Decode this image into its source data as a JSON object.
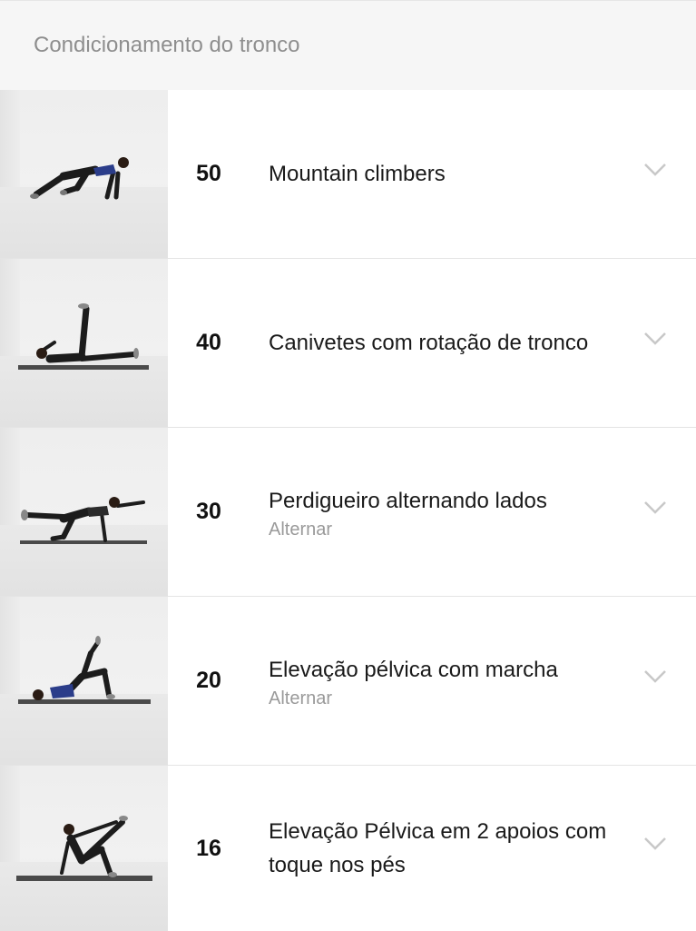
{
  "header": {
    "title": "Condicionamento do tronco"
  },
  "exercises": [
    {
      "reps": "50",
      "name": "Mountain climbers",
      "sub": ""
    },
    {
      "reps": "40",
      "name": "Canivetes com rotação de tronco",
      "sub": ""
    },
    {
      "reps": "30",
      "name": "Perdigueiro alternando lados",
      "sub": "Alternar"
    },
    {
      "reps": "20",
      "name": "Elevação pélvica com marcha",
      "sub": "Alternar"
    },
    {
      "reps": "16",
      "name": "Elevação Pélvica em 2 apoios com toque nos pés",
      "sub": ""
    }
  ],
  "icons": {
    "expand": "chevron-down-icon"
  },
  "colors": {
    "header_bg": "#f6f6f6",
    "divider": "#e4e4e4",
    "secondary_text": "#9a9a9a"
  }
}
